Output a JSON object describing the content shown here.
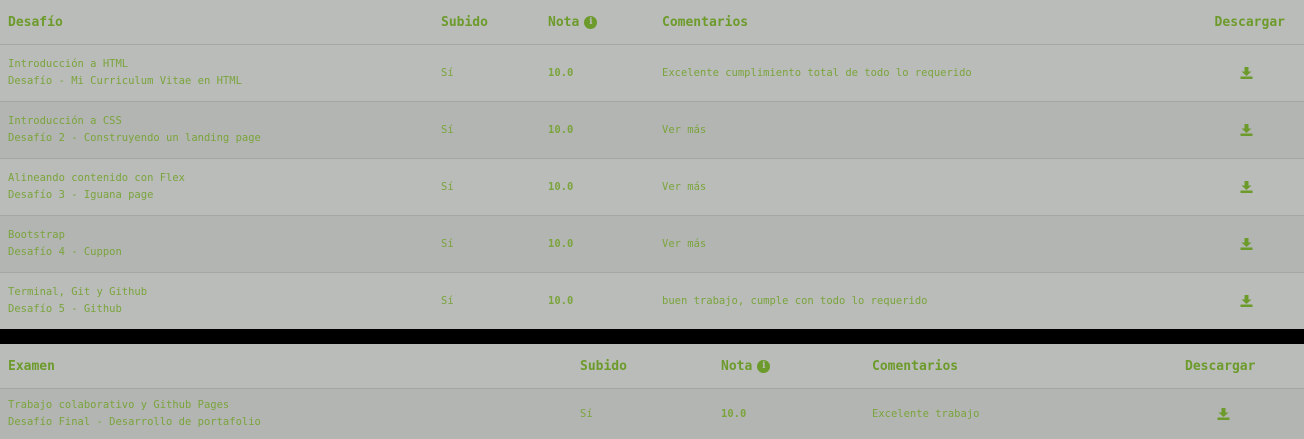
{
  "desafios": {
    "headers": {
      "desafio": "Desafío",
      "subido": "Subido",
      "nota": "Nota",
      "comentarios": "Comentarios",
      "descargar": "Descargar"
    },
    "rows": [
      {
        "modulo": "Introducción a HTML",
        "titulo": "Desafío - Mi Curriculum Vitae en HTML",
        "subido": "Sí",
        "nota": "10.0",
        "comentario": "Excelente cumplimiento total de todo lo requerido"
      },
      {
        "modulo": "Introducción a CSS",
        "titulo": "Desafío 2 - Construyendo un landing page",
        "subido": "Sí",
        "nota": "10.0",
        "comentario": "Ver más"
      },
      {
        "modulo": "Alineando contenido con Flex",
        "titulo": "Desafío 3 - Iguana page",
        "subido": "Sí",
        "nota": "10.0",
        "comentario": "Ver más"
      },
      {
        "modulo": "Bootstrap",
        "titulo": "Desafío 4 - Cuppon",
        "subido": "Sí",
        "nota": "10.0",
        "comentario": "Ver más"
      },
      {
        "modulo": "Terminal, Git y Github",
        "titulo": "Desafío 5 - Github",
        "subido": "Sí",
        "nota": "10.0",
        "comentario": "buen trabajo, cumple con todo lo requerido"
      }
    ]
  },
  "examen": {
    "headers": {
      "examen": "Examen",
      "subido": "Subido",
      "nota": "Nota",
      "comentarios": "Comentarios",
      "descargar": "Descargar"
    },
    "rows": [
      {
        "modulo": "Trabajo colaborativo y Github Pages",
        "titulo": "Desafío Final - Desarrollo de portafolio",
        "subido": "Sí",
        "nota": "10.0",
        "comentario": "Excelente trabajo"
      }
    ]
  },
  "icons": {
    "info": "info-circle-icon",
    "download": "download-icon"
  },
  "colors": {
    "accent": "#6d9b2b",
    "panel_bg": "#b9bcb8",
    "separator": "#000000"
  }
}
